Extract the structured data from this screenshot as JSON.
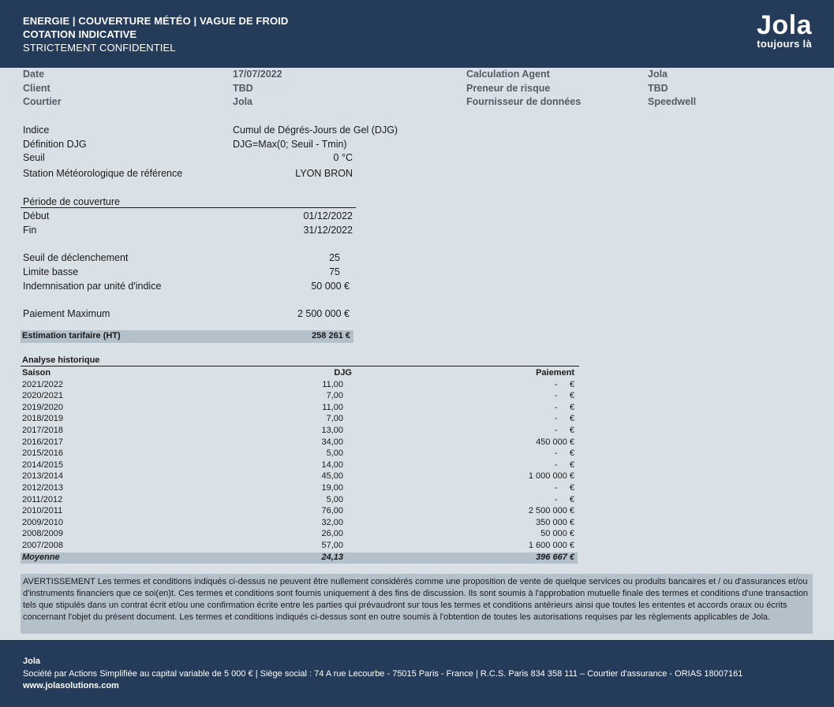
{
  "header": {
    "line1": "ENERGIE |  COUVERTURE MÉTÉO | VAGUE DE FROID",
    "line2": "COTATION INDICATIVE",
    "line3": "STRICTEMENT CONFIDENTIEL",
    "logo": "Jola",
    "tagline": "toujours là"
  },
  "summary": {
    "date_label": "Date",
    "date_value": "17/07/2022",
    "client_label": "Client",
    "client_value": "TBD",
    "broker_label": "Courtier",
    "broker_value": "Jola",
    "calc_agent_label": "Calculation Agent",
    "calc_agent_value": "Jola",
    "risk_taker_label": "Preneur de risque",
    "risk_taker_value": "TBD",
    "data_provider_label": "Fournisseur de données",
    "data_provider_value": "Speedwell"
  },
  "index": {
    "indice_label": "Indice",
    "indice_value": "Cumul de Dégrés-Jours de Gel (DJG)",
    "def_label": "Définition DJG",
    "def_value": "DJG=Max(0; Seuil - Tmin)",
    "seuil_label": "Seuil",
    "seuil_value": "0 °C",
    "station_label": "Station Météorologique de référence",
    "station_value": "LYON  BRON"
  },
  "period": {
    "title": "Période de couverture",
    "start_label": "Début",
    "start_value": "01/12/2022",
    "end_label": "Fin",
    "end_value": "31/12/2022"
  },
  "terms": {
    "trigger_label": "Seuil de déclenchement",
    "trigger_value": "25",
    "floor_label": "Limite basse",
    "floor_value": "75",
    "indemnity_label": "Indemnisation par unité d'indice",
    "indemnity_value": "50 000 €",
    "max_label": "Paiement Maximum",
    "max_value": "2 500 000 €",
    "estimate_label": "Estimation tarifaire (HT)",
    "estimate_value": "258 261 €"
  },
  "history": {
    "title": "Analyse historique",
    "col_season": "Saison",
    "col_djg": "DJG",
    "col_payment": "Paiement",
    "rows": [
      {
        "season": "2021/2022",
        "djg": "11,00",
        "payment": "-     €"
      },
      {
        "season": "2020/2021",
        "djg": "7,00",
        "payment": "-     €"
      },
      {
        "season": "2019/2020",
        "djg": "11,00",
        "payment": "-     €"
      },
      {
        "season": "2018/2019",
        "djg": "7,00",
        "payment": "-     €"
      },
      {
        "season": "2017/2018",
        "djg": "13,00",
        "payment": "-     €"
      },
      {
        "season": "2016/2017",
        "djg": "34,00",
        "payment": "450 000 €"
      },
      {
        "season": "2015/2016",
        "djg": "5,00",
        "payment": "-     €"
      },
      {
        "season": "2014/2015",
        "djg": "14,00",
        "payment": "-     €"
      },
      {
        "season": "2013/2014",
        "djg": "45,00",
        "payment": "1 000 000 €"
      },
      {
        "season": "2012/2013",
        "djg": "19,00",
        "payment": "-     €"
      },
      {
        "season": "2011/2012",
        "djg": "5,00",
        "payment": "-     €"
      },
      {
        "season": "2010/2011",
        "djg": "76,00",
        "payment": "2 500 000 €"
      },
      {
        "season": "2009/2010",
        "djg": "32,00",
        "payment": "350 000 €"
      },
      {
        "season": "2008/2009",
        "djg": "26,00",
        "payment": "50 000 €"
      },
      {
        "season": "2007/2008",
        "djg": "57,00",
        "payment": "1 600 000 €"
      }
    ],
    "avg_label": "Moyenne",
    "avg_djg": "24,13",
    "avg_payment": "396 667 €"
  },
  "disclaimer": "AVERTISSEMENT Les termes et conditions indiqués ci-dessus ne peuvent être nullement considérés comme une proposition de vente de quelque services ou produits bancaires et / ou d'assurances et/ou d'instruments financiers que ce soi(en)t. Ces termes et conditions sont fournis uniquement à des fins de discussion. Ils sont soumis à l'approbation mutuelle finale des termes et conditions d'une transaction tels que stipulés dans un contrat écrit et/ou une confirmation écrite entre les parties qui prévaudront sur tous les termes et conditions antérieurs ainsi que toutes les ententes et accords oraux ou écrits concernant l'objet du présent document. Les termes et conditions indiqués ci-dessus sont en outre soumis à l'obtention de toutes les autorisations requises par les règlements applicables de Jola.",
  "footer": {
    "company": "Jola",
    "legal": "Société par Actions Simplifiée au capital variable de 5 000 € | Siège social : 74 A rue Lecourbe - 75015 Paris - France | R.C.S. Paris 834 358 111 – Courtier d'assurance - ORIAS 18007161",
    "website": "www.jolasolutions.com"
  }
}
